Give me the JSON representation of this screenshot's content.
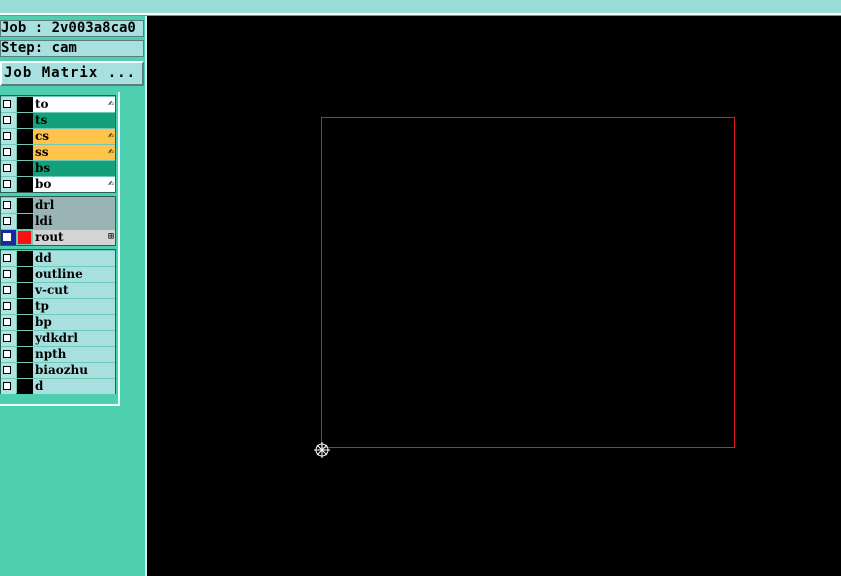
{
  "header": {
    "job": "Job : 2v003a8ca0",
    "step": "Step: cam",
    "matrix_button": "Job Matrix ..."
  },
  "layers": {
    "board": [
      {
        "name": "to",
        "bg": "#ffffff",
        "mark": "✍"
      },
      {
        "name": "ts",
        "bg": "#13a07a",
        "mark": ""
      },
      {
        "name": "cs",
        "bg": "#ffc24a",
        "mark": "✍"
      },
      {
        "name": "ss",
        "bg": "#ffc24a",
        "mark": "✍"
      },
      {
        "name": "bs",
        "bg": "#13a07a",
        "mark": ""
      },
      {
        "name": "bo",
        "bg": "#ffffff",
        "mark": "✍"
      }
    ],
    "drill": [
      {
        "name": "drl",
        "bg": "#9ab4b6",
        "mark": ""
      },
      {
        "name": "ldi",
        "bg": "#9ab4b6",
        "mark": ""
      },
      {
        "name": "rout",
        "bg": "#d4d4d4",
        "mark": "⊞",
        "selected": true
      }
    ],
    "misc": [
      {
        "name": "dd",
        "bg": "#a8e0e0",
        "mark": ""
      },
      {
        "name": "outline",
        "bg": "#a8e0e0",
        "mark": ""
      },
      {
        "name": "v-cut",
        "bg": "#a8e0e0",
        "mark": ""
      },
      {
        "name": "tp",
        "bg": "#a8e0e0",
        "mark": ""
      },
      {
        "name": "bp",
        "bg": "#a8e0e0",
        "mark": ""
      },
      {
        "name": "ydkdrl",
        "bg": "#a8e0e0",
        "mark": ""
      },
      {
        "name": "npth",
        "bg": "#a8e0e0",
        "mark": ""
      },
      {
        "name": "biaozhu",
        "bg": "#a8e0e0",
        "mark": ""
      },
      {
        "name": "d",
        "bg": "#a8e0e0",
        "mark": ""
      }
    ]
  },
  "canvas": {
    "background": "#000000",
    "profile_color": "#e41818"
  }
}
